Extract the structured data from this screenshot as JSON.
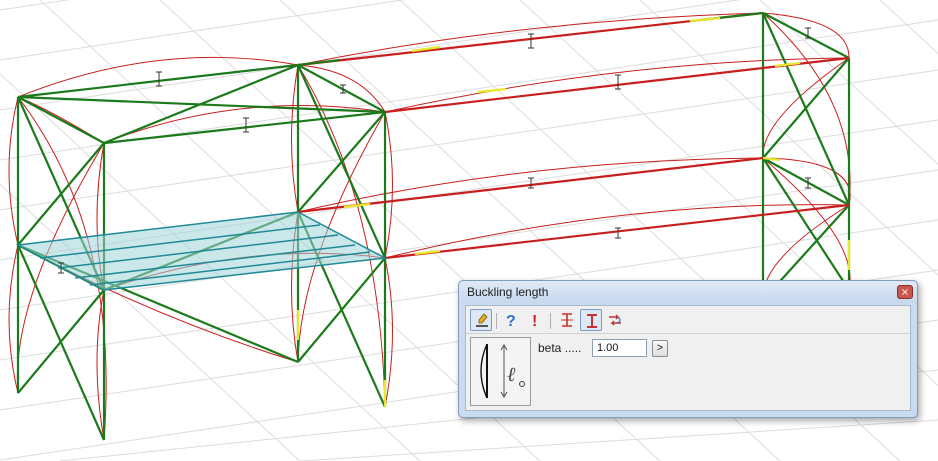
{
  "model_view": {
    "description_icon": "steel-frame-3d-view"
  },
  "dialog": {
    "title": "Buckling length",
    "close_label": "×",
    "toolbar": {
      "icons": [
        "edit-icon",
        "help-icon",
        "warning-icon",
        "member-buckling-icon",
        "member-buckling-active-icon",
        "swap-icon"
      ]
    },
    "preview_icon": "buckling-length-diagram-icon",
    "beta_label": "beta .....",
    "beta_value": "1.00",
    "arrow_label": ">"
  },
  "colors": {
    "member_green": "#1b7a1b",
    "member_red": "#c81e1e",
    "member_yellow": "#e8e82a",
    "slab_teal": "#1f8a95",
    "dialog_frame": "#c9dbef"
  }
}
